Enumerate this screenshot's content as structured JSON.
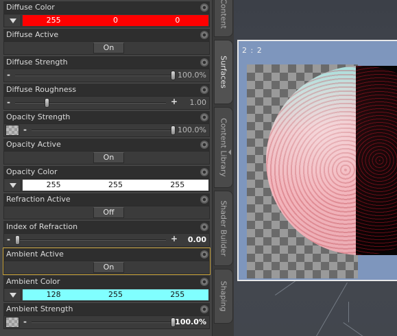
{
  "properties": [
    {
      "label": "Diffuse Color",
      "type": "color",
      "values": [
        "255",
        "0",
        "0"
      ],
      "bg": "#ff0000",
      "fg": "#ffffff"
    },
    {
      "label": "Diffuse Active",
      "type": "toggle",
      "state": "On"
    },
    {
      "label": "Diffuse Strength",
      "type": "slider",
      "value_text": "100.0%",
      "fraction": 1.0,
      "minus": "-",
      "plus": ""
    },
    {
      "label": "Diffuse Roughness",
      "type": "slider",
      "value_text": "1.00",
      "fraction": 0.2,
      "minus": "-",
      "plus": "+"
    },
    {
      "label": "Opacity Strength",
      "type": "slider_map",
      "value_text": "100.0%",
      "fraction": 1.0,
      "minus": "-",
      "plus": ""
    },
    {
      "label": "Opacity Active",
      "type": "toggle",
      "state": "On"
    },
    {
      "label": "Opacity Color",
      "type": "color",
      "values": [
        "255",
        "255",
        "255"
      ],
      "bg": "#ffffff",
      "fg": "#111111"
    },
    {
      "label": "Refraction Active",
      "type": "toggle",
      "state": "Off"
    },
    {
      "label": "Index of Refraction",
      "type": "slider",
      "value_text": "0.00",
      "fraction": 0.0,
      "minus": "-",
      "plus": "+",
      "bold": true
    },
    {
      "label": "Ambient Active",
      "type": "toggle",
      "state": "On",
      "selected": true
    },
    {
      "label": "Ambient Color",
      "type": "color",
      "values": [
        "128",
        "255",
        "255"
      ],
      "bg": "#80ffff",
      "fg": "#111111"
    },
    {
      "label": "Ambient Strength",
      "type": "slider_map",
      "value_text": "100.0%",
      "fraction": 1.0,
      "minus": "-",
      "plus": "",
      "bold": true
    }
  ],
  "tabs": [
    {
      "label": "Content",
      "active": false
    },
    {
      "label": "Surfaces",
      "active": true
    },
    {
      "label": "Content Library",
      "active": false
    },
    {
      "label": "Shader Builder",
      "active": false
    },
    {
      "label": "Shaping",
      "active": false
    }
  ],
  "viewport": {
    "frame_label": "2 : 2"
  },
  "icons": {
    "gear": "gear-icon",
    "dropdown": "chevron-down-icon",
    "map": "texture-map-icon"
  }
}
